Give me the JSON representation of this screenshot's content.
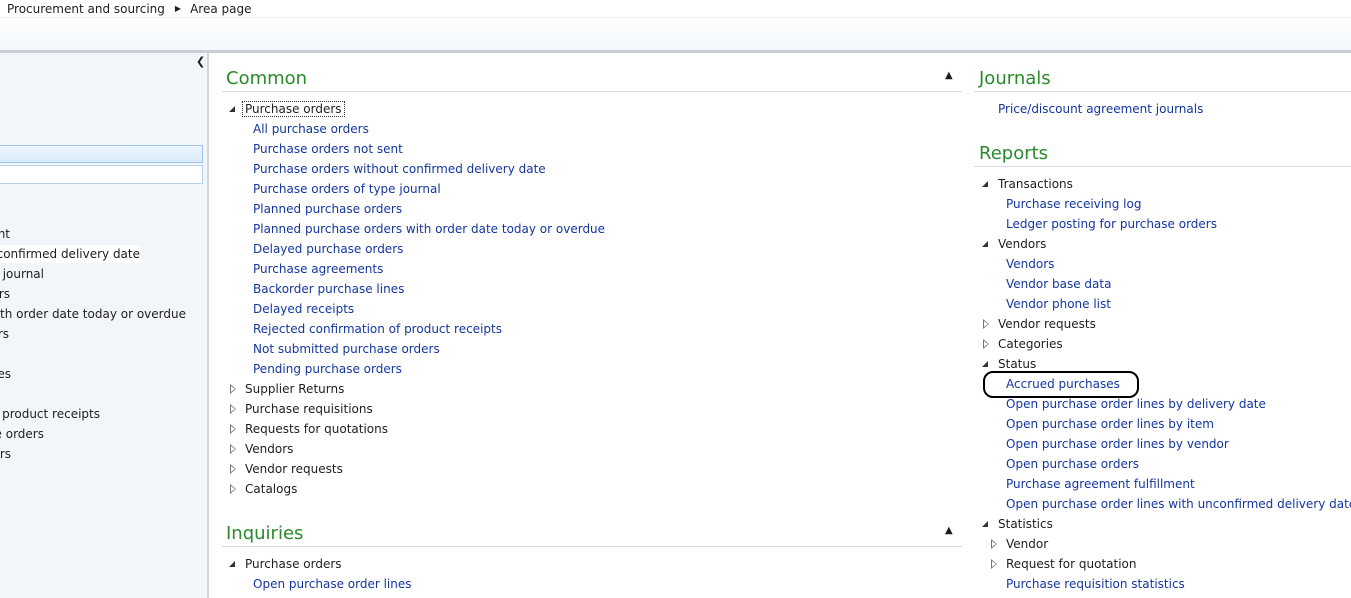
{
  "breadcrumb": {
    "items": [
      "Procurement and sourcing",
      "Area page"
    ],
    "separator_icon": "right-triangle-icon"
  },
  "navpane": {
    "collapse_icon": "chevron-left-icon",
    "items": [
      "nt",
      "ut confirmed delivery date",
      "e journal",
      "rs",
      "ers with order date today or overdue",
      "rs",
      "es",
      "of product receipts",
      "se orders",
      "rs"
    ]
  },
  "common": {
    "title": "Common",
    "group": "Purchase orders",
    "links": [
      "All purchase orders",
      "Purchase orders not sent",
      "Purchase orders without confirmed delivery date",
      "Purchase orders of type journal",
      "Planned purchase orders",
      "Planned purchase orders with order date today or overdue",
      "Delayed purchase orders",
      "Purchase agreements",
      "Backorder purchase lines",
      "Delayed receipts",
      "Rejected confirmation of product receipts",
      "Not submitted purchase orders",
      "Pending purchase orders"
    ],
    "collapsed_groups": [
      "Supplier Returns",
      "Purchase requisitions",
      "Requests for quotations",
      "Vendors",
      "Vendor requests",
      "Catalogs"
    ]
  },
  "inquiries": {
    "title": "Inquiries",
    "group": "Purchase orders",
    "links": [
      "Open purchase order lines"
    ]
  },
  "journals": {
    "title": "Journals",
    "links": [
      "Price/discount agreement journals"
    ]
  },
  "reports": {
    "title": "Reports",
    "transactions": {
      "label": "Transactions",
      "links": [
        "Purchase receiving log",
        "Ledger posting for purchase orders"
      ]
    },
    "vendors": {
      "label": "Vendors",
      "links": [
        "Vendors",
        "Vendor base data",
        "Vendor phone list"
      ]
    },
    "vendor_requests": "Vendor requests",
    "categories": "Categories",
    "status": {
      "label": "Status",
      "links": [
        "Accrued purchases",
        "Open purchase order lines by delivery date",
        "Open purchase order lines by item",
        "Open purchase order lines by vendor",
        "Open purchase orders",
        "Purchase agreement fulfillment",
        "Open purchase order lines with unconfirmed delivery date"
      ]
    },
    "statistics": {
      "label": "Statistics",
      "subgroups": [
        "Vendor",
        "Request for quotation"
      ],
      "links": [
        "Purchase requisition statistics"
      ]
    }
  }
}
